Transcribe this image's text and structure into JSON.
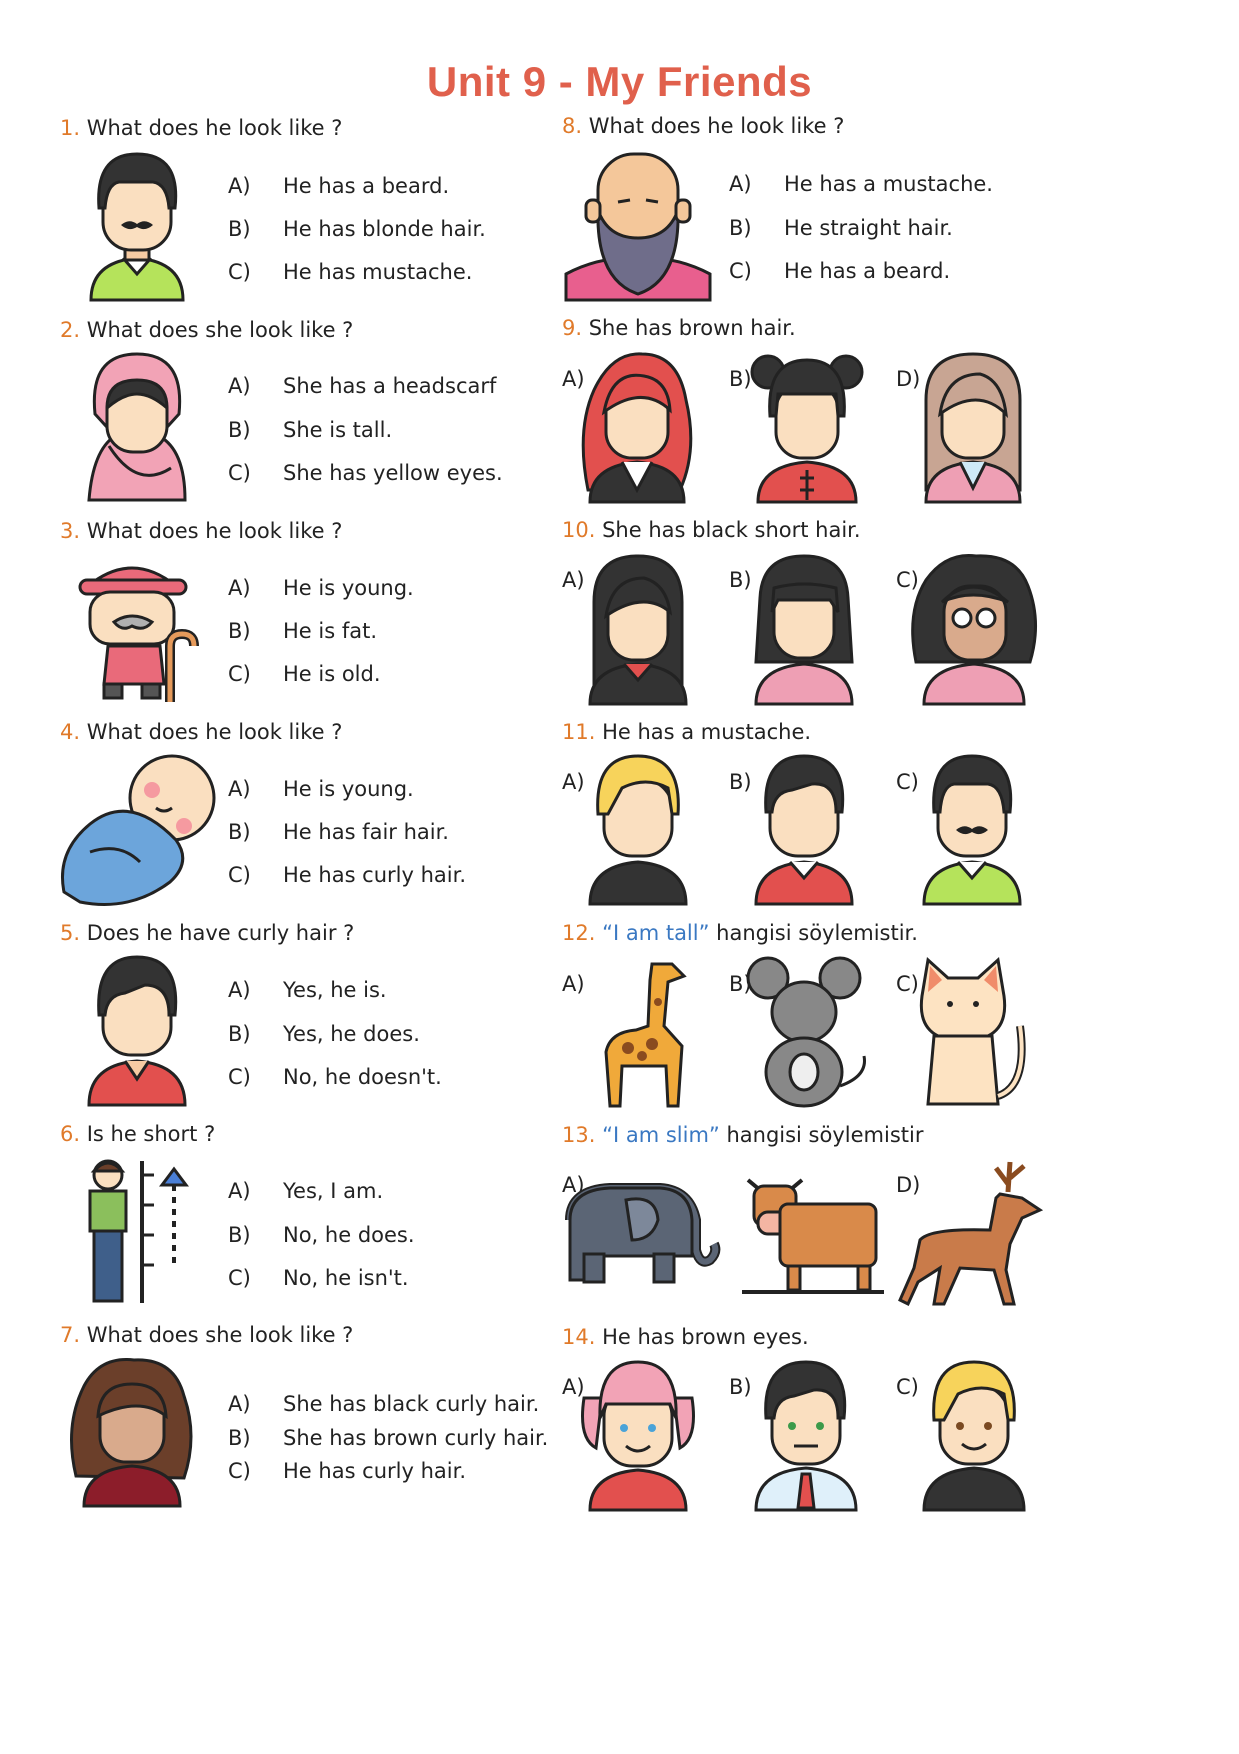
{
  "title": "Unit 9 - My Friends",
  "questions": [
    {
      "num": "1.",
      "text": " What does he look like ?",
      "options": [
        [
          "A)",
          "He has a beard."
        ],
        [
          "B)",
          "He has blonde hair."
        ],
        [
          "C)",
          "He has mustache."
        ]
      ]
    },
    {
      "num": "2.",
      "text": " What does she look like ?",
      "options": [
        [
          "A)",
          "She has a headscarf"
        ],
        [
          "B)",
          "She is tall."
        ],
        [
          "C)",
          "She has yellow eyes."
        ]
      ]
    },
    {
      "num": "3.",
      "text": " What does he look  like ?",
      "options": [
        [
          "A)",
          "He is young."
        ],
        [
          "B)",
          "He is fat."
        ],
        [
          "C)",
          "He is old."
        ]
      ]
    },
    {
      "num": "4.",
      "text": " What does he look  like ?",
      "options": [
        [
          "A)",
          "He is young."
        ],
        [
          "B)",
          "He has fair hair."
        ],
        [
          "C)",
          "He has curly hair."
        ]
      ]
    },
    {
      "num": "5.",
      "text": " Does he have curly hair ?",
      "options": [
        [
          "A)",
          "Yes, he is."
        ],
        [
          "B)",
          "Yes, he does."
        ],
        [
          "C)",
          "No, he doesn't."
        ]
      ]
    },
    {
      "num": "6.",
      "text": " Is he short ?",
      "options": [
        [
          "A)",
          "Yes, I am."
        ],
        [
          "B)",
          "No, he does."
        ],
        [
          "C)",
          "No, he isn't."
        ]
      ]
    },
    {
      "num": "7.",
      "text": " What does she look  like ?",
      "options": [
        [
          "A)",
          "She has black curly hair."
        ],
        [
          "B)",
          "She has brown curly hair."
        ],
        [
          "C)",
          "He has curly hair."
        ]
      ]
    },
    {
      "num": "8.",
      "text": " What does he look  like ?",
      "options": [
        [
          "A)",
          "He has a mustache."
        ],
        [
          "B)",
          "He straight hair."
        ],
        [
          "C)",
          "He has a beard."
        ]
      ]
    },
    {
      "num": "9.",
      "text": " She has brown hair.",
      "labels": [
        "A)",
        "B)",
        "D)"
      ]
    },
    {
      "num": "10.",
      "text": " She has black short hair.",
      "labels": [
        "A)",
        "B)",
        "C)"
      ]
    },
    {
      "num": "11.",
      "text": " He has a mustache.",
      "labels": [
        "A)",
        "B)",
        "C)"
      ]
    },
    {
      "num": "12.",
      "quote": " “I am tall”",
      "text": " hangisi söylemistir.",
      "labels": [
        "A)",
        "B)",
        "C)"
      ]
    },
    {
      "num": "13.",
      "quote": " “I am slim”",
      "text": " hangisi söylemistir",
      "labels": [
        "A)",
        "",
        "D)"
      ]
    },
    {
      "num": "14.",
      "text": " He has brown eyes.",
      "labels": [
        "A)",
        "B)",
        "C)"
      ]
    }
  ],
  "icons": {
    "q1": "man-mustache-icon",
    "q2": "woman-headscarf-icon",
    "q3": "old-man-cane-icon",
    "q4": "baby-blanket-icon",
    "q5": "boy-red-shirt-icon",
    "q6": "man-height-chart-icon",
    "q7": "woman-curly-hair-icon",
    "q8": "bald-bearded-man-icon",
    "q9": [
      "woman-red-hair-icon",
      "woman-black-buns-icon",
      "woman-brown-hair-icon"
    ],
    "q10": [
      "woman-long-black-hair-icon",
      "woman-short-black-hair-icon",
      "woman-curly-glasses-icon"
    ],
    "q11": [
      "man-blonde-icon",
      "man-black-hair-icon",
      "man-mustache-icon"
    ],
    "q12": [
      "giraffe-icon",
      "mouse-icon",
      "cat-icon"
    ],
    "q13": [
      "elephant-icon",
      "cow-icon",
      "deer-icon"
    ],
    "q14": [
      "girl-pink-pigtails-icon",
      "man-green-eyes-icon",
      "man-blonde-brown-eyes-icon"
    ]
  },
  "colors": {
    "title": "#e0604c",
    "number": "#e07a2a",
    "quote": "#3a78c2"
  }
}
